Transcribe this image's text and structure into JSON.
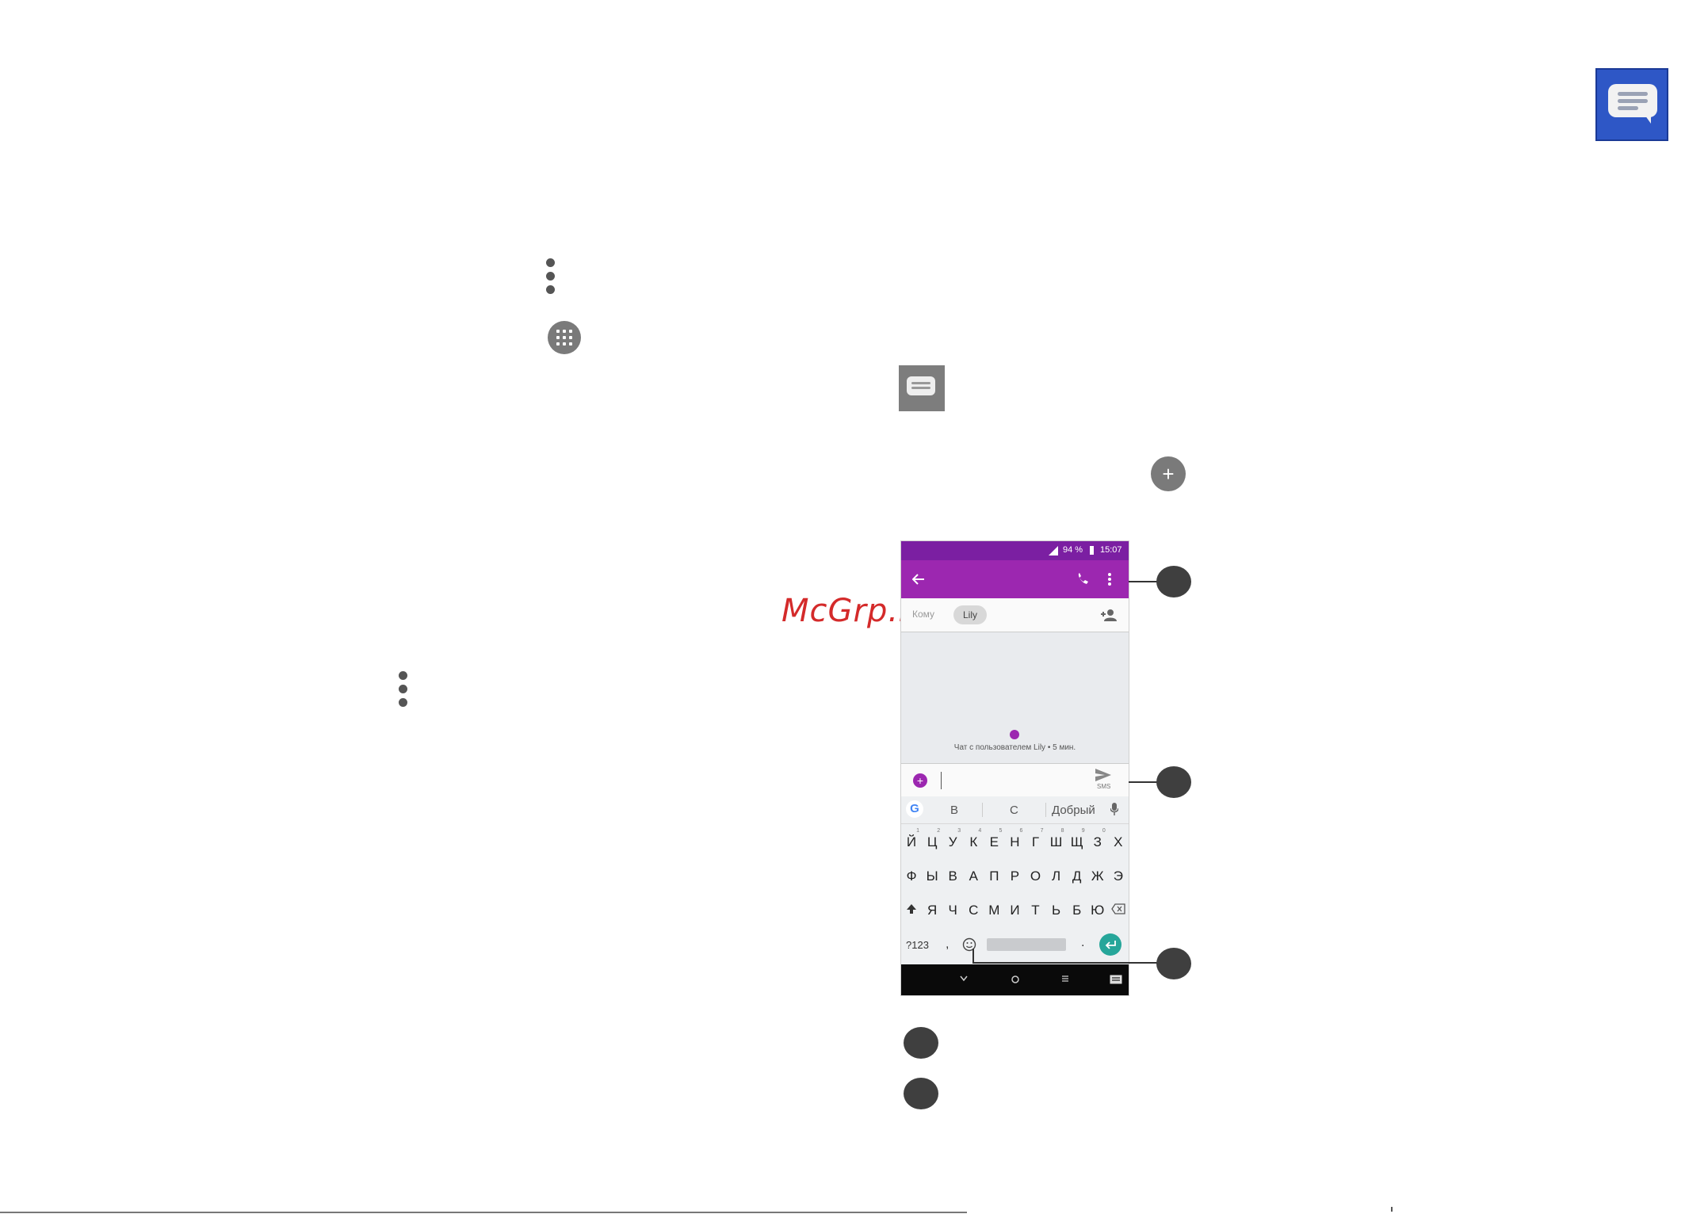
{
  "watermark": "McGrp.Ru",
  "phone": {
    "status": {
      "battery": "94 %",
      "time": "15:07"
    },
    "recipients": {
      "hint": "Кому",
      "chip": "Lily"
    },
    "conversation": {
      "info": "Чат с пользователем Lily • 5 мин."
    },
    "compose": {
      "send_label": "SMS"
    },
    "keyboard": {
      "suggestions": [
        "В",
        "С",
        "Добрый"
      ],
      "row1": [
        "Й",
        "Ц",
        "У",
        "К",
        "Е",
        "Н",
        "Г",
        "Ш",
        "Щ",
        "З",
        "Х"
      ],
      "row1_hints": [
        "1",
        "2",
        "3",
        "4",
        "5",
        "6",
        "7",
        "8",
        "9",
        "0",
        ""
      ],
      "row2": [
        "Ф",
        "Ы",
        "В",
        "А",
        "П",
        "Р",
        "О",
        "Л",
        "Д",
        "Ж",
        "Э"
      ],
      "row3": [
        "Я",
        "Ч",
        "С",
        "М",
        "И",
        "Т",
        "Ь",
        "Б",
        "Ю"
      ],
      "row4": {
        "symbols": "?123",
        "comma": ",",
        "period": "."
      }
    }
  },
  "icons": {
    "app_logo": "messages-icon",
    "menu": "more-vert-icon",
    "apps": "apps-grid-icon",
    "new_message": "add-icon"
  },
  "colors": {
    "logo_blue": "#2e57c6",
    "appbar_purple": "#9c27b0",
    "statusbar_purple": "#7b1fa2",
    "enter_teal": "#26a69a",
    "watermark_red": "#d42a2a"
  }
}
